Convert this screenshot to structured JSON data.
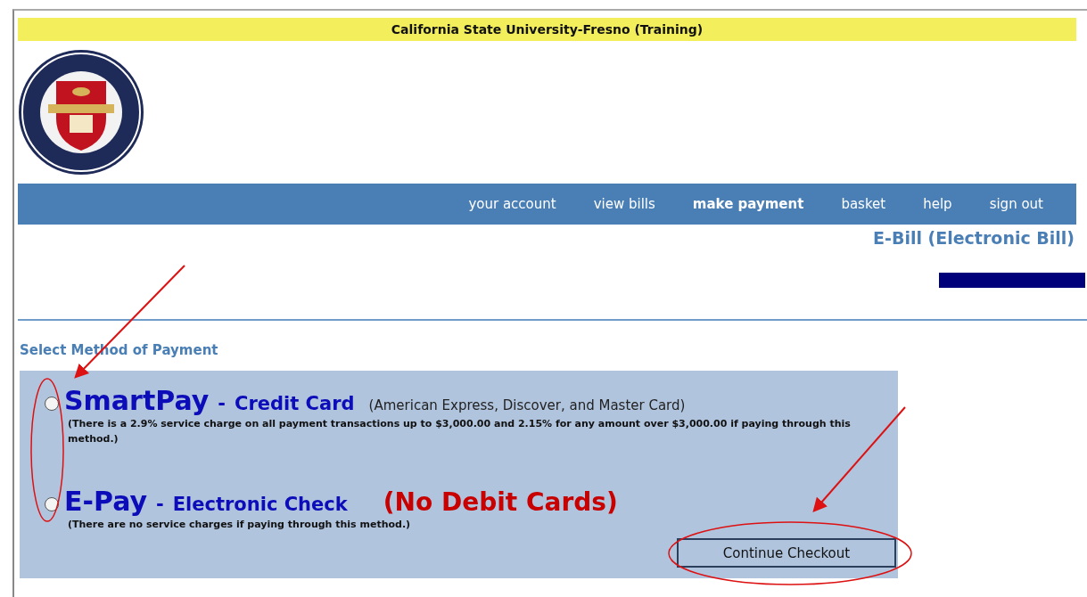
{
  "header": {
    "title": "California State University-Fresno (Training)"
  },
  "nav": [
    {
      "label": "your account",
      "selected": false
    },
    {
      "label": "view bills",
      "selected": false
    },
    {
      "label": "make payment",
      "selected": true
    },
    {
      "label": "basket",
      "selected": false
    },
    {
      "label": "help",
      "selected": false
    },
    {
      "label": "sign out",
      "selected": false
    }
  ],
  "page_title": "E-Bill (Electronic Bill)",
  "section_title": "Select Method of Payment",
  "methods": [
    {
      "name": "SmartPay",
      "separator": "-",
      "type": "Credit Card",
      "note": "(American Express, Discover, and Master Card)",
      "detail": "(There is a 2.9% service charge on all payment transactions up to $3,000.00 and 2.15% for any amount over $3,000.00 if paying through this method.)",
      "selected": false
    },
    {
      "name": "E-Pay",
      "separator": "-",
      "type": "Electronic Check",
      "warning": "(No Debit Cards)",
      "detail": "(There are no service charges if paying through this method.)",
      "selected": false
    }
  ],
  "button": "Continue Checkout"
}
